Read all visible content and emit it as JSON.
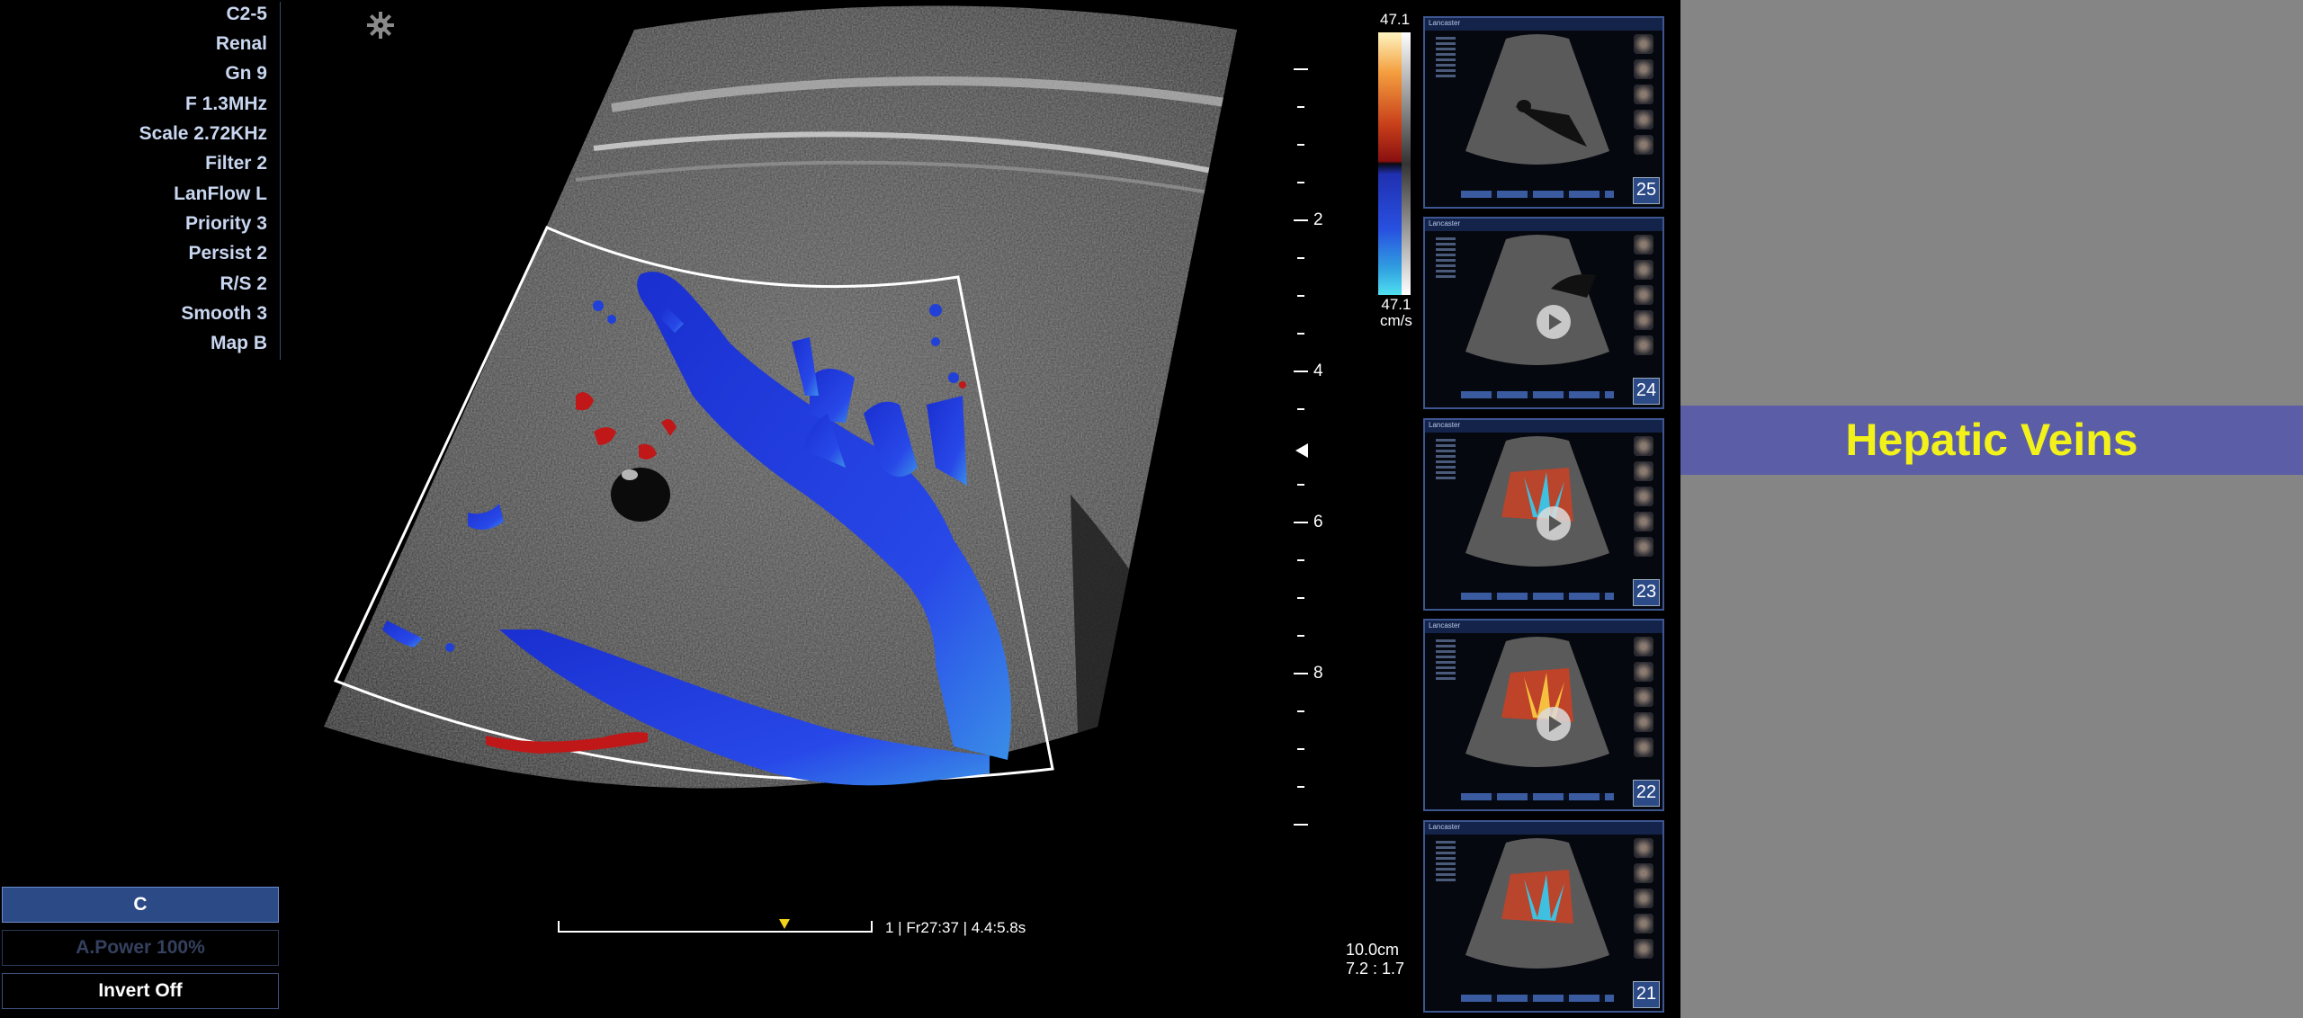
{
  "params": [
    "C2-5",
    "Renal",
    "Gn 9",
    "F 1.3MHz",
    "Scale 2.72KHz",
    "Filter 2",
    "LanFlow L",
    "Priority 3",
    "Persist 2",
    "R/S 2",
    "Smooth 3",
    "Map B"
  ],
  "buttons": {
    "mode": "C",
    "power": "A.Power 100%",
    "invert": "Invert  Off"
  },
  "depth_labels": [
    "2",
    "4",
    "6",
    "8"
  ],
  "frame_info": "1 | Fr27:37 | 4.4:5.8s",
  "depth_info": {
    "depth": "10.0cm",
    "ratio": "7.2 : 1.7"
  },
  "colorbar": {
    "top": "47.1",
    "bottom": "47.1",
    "unit": "cm/s"
  },
  "thumbnails": [
    {
      "number": "25",
      "has_play": false,
      "type": "bmode"
    },
    {
      "number": "24",
      "has_play": true,
      "type": "bmode"
    },
    {
      "number": "23",
      "has_play": true,
      "type": "color"
    },
    {
      "number": "22",
      "has_play": true,
      "type": "color"
    },
    {
      "number": "21",
      "has_play": false,
      "type": "color"
    }
  ],
  "thumb_header": {
    "left": "Lancaster"
  },
  "title": "Hepatic Veins",
  "colors": {
    "title_text": "#f2f21a",
    "title_band": "#5b5ea6",
    "panel_gray": "#858585",
    "flow_blue": "#2244e0",
    "flow_red": "#c01818"
  }
}
